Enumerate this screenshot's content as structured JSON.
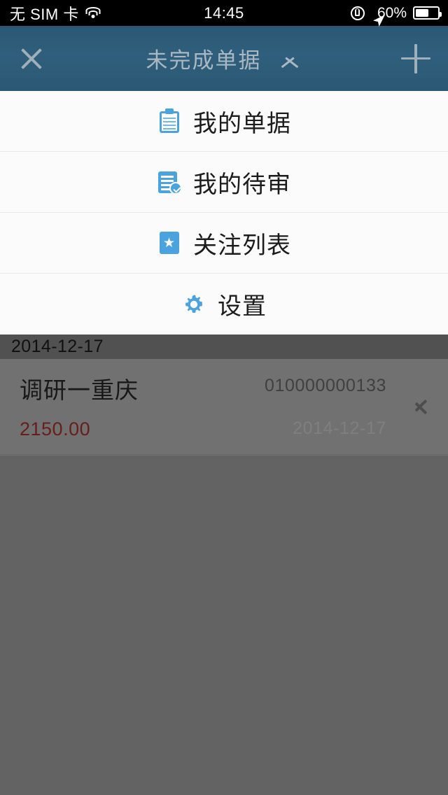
{
  "status_bar": {
    "carrier": "无 SIM 卡",
    "wifi_icon": "wifi-icon",
    "time": "14:45",
    "rotation_lock_icon": "rotation-lock-icon",
    "location_icon": "location-arrow-icon",
    "battery_percent": "60%",
    "battery_level": 60
  },
  "nav_bar": {
    "close_icon": "close-icon",
    "title": "未完成单据",
    "collapse_icon": "chevron-up-icon",
    "add_icon": "plus-icon",
    "background_color": "#2f5f7c"
  },
  "menu": {
    "accent_color": "#4aa3df",
    "items": [
      {
        "label": "我的单据",
        "icon": "clipboard-icon"
      },
      {
        "label": "我的待审",
        "icon": "checklist-check-icon"
      },
      {
        "label": "关注列表",
        "icon": "star-icon"
      },
      {
        "label": "设置",
        "icon": "gear-icon"
      }
    ]
  },
  "list": {
    "date_header": "2014-12-17",
    "rows": [
      {
        "title": "调研一重庆",
        "doc_number": "010000000133",
        "amount": "2150.00",
        "amount_color": "#7d2722",
        "date": "2014-12-17",
        "chevron_icon": "chevron-right-icon"
      }
    ]
  }
}
